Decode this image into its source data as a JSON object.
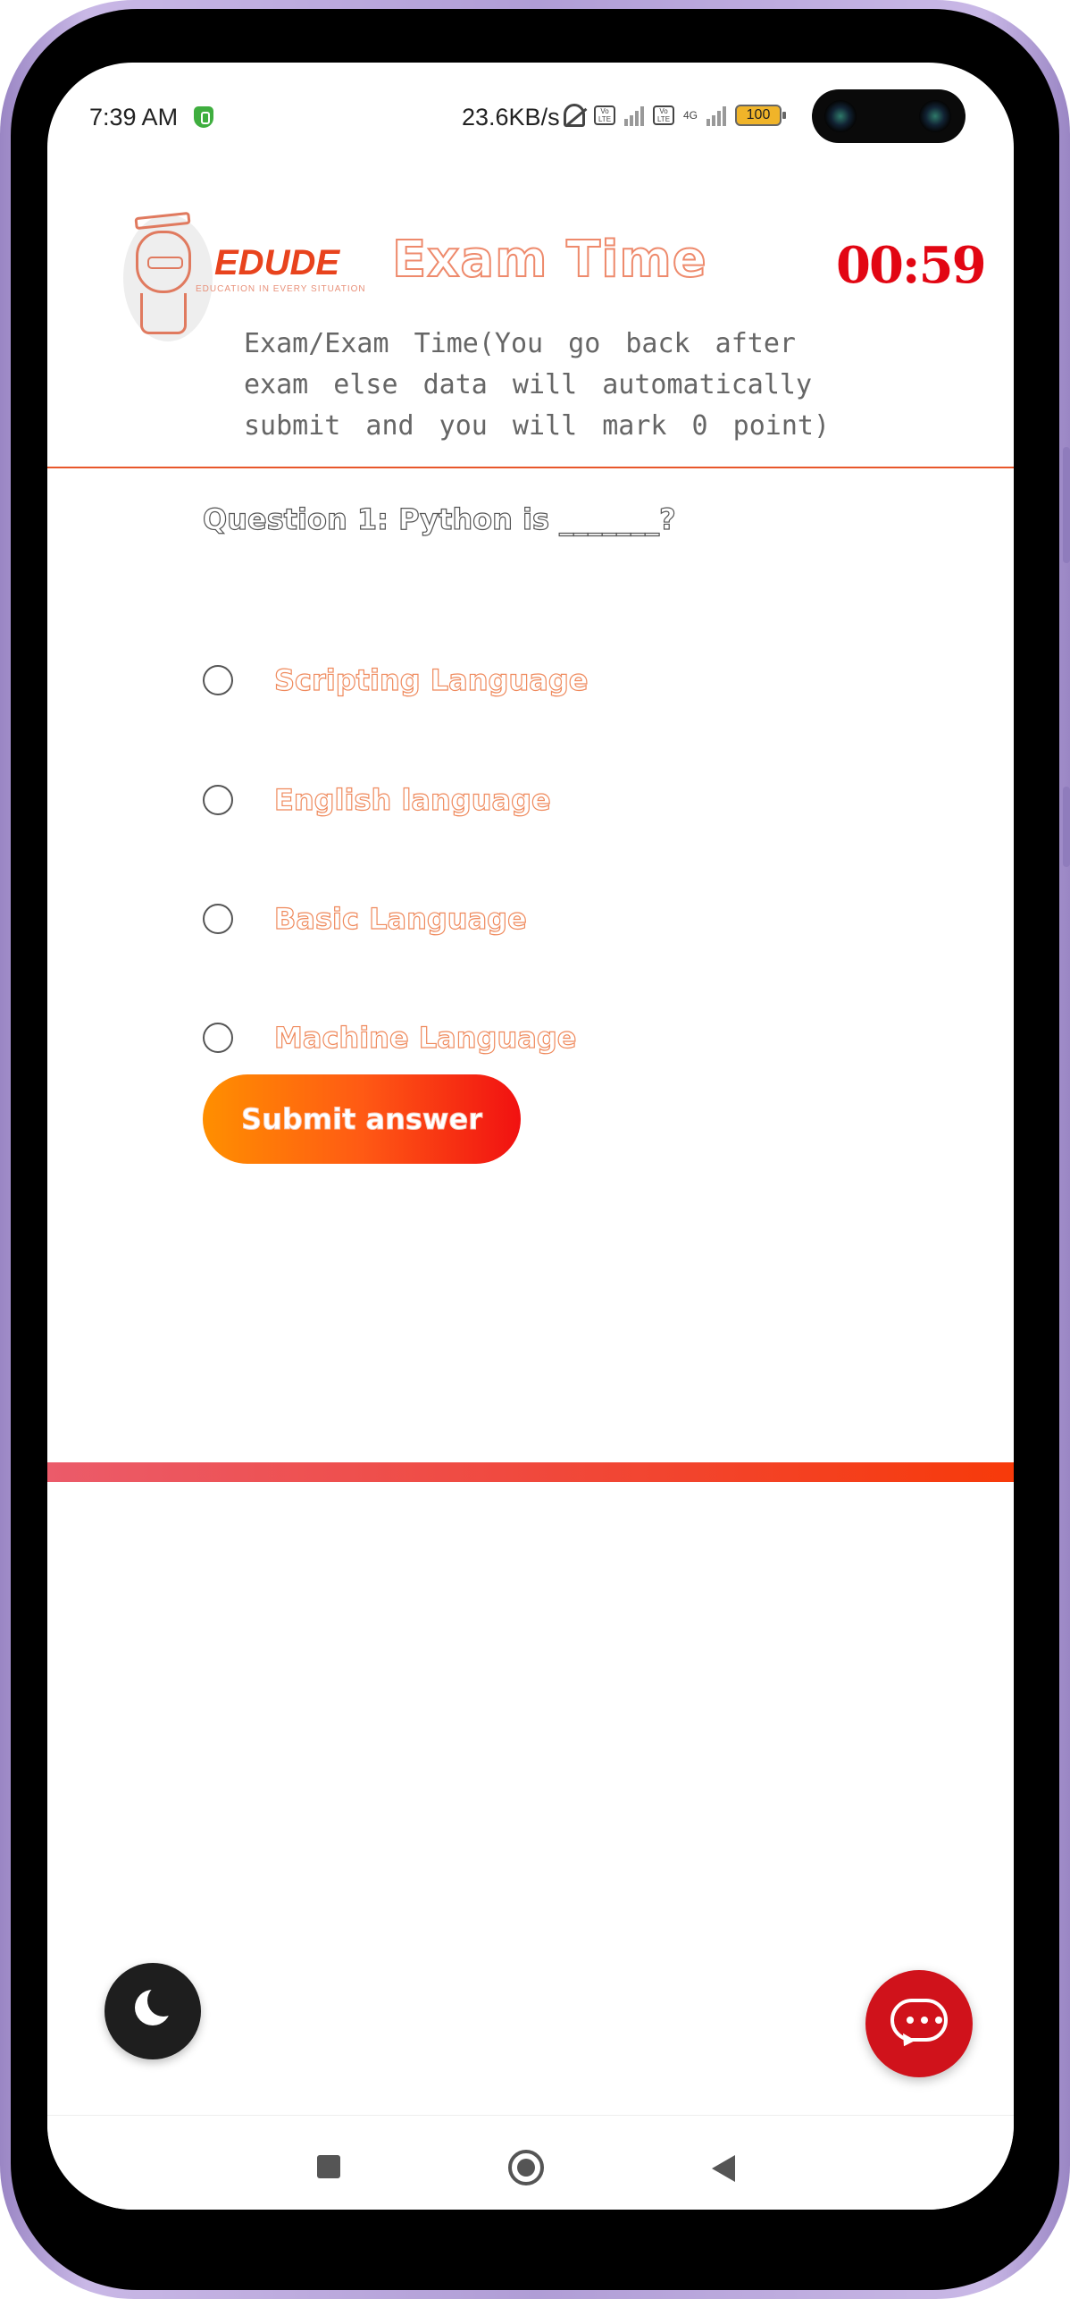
{
  "status_bar": {
    "time": "7:39 AM",
    "network_speed": "23.6KB/s",
    "battery": "100",
    "icons": [
      "shield-icon",
      "bell-muted-icon",
      "volte-icon",
      "signal-icon",
      "4g-icon",
      "battery-icon"
    ]
  },
  "header": {
    "brand_name": "EDUDE",
    "brand_tagline": "EDUCATION IN EVERY SITUATION",
    "title": "Exam Time",
    "timer": "00:59"
  },
  "notice": "Exam/Exam Time(You go back after exam else data will automatically submit and you will mark 0 point)",
  "question": {
    "text": "Question 1: Python is _______?",
    "options": [
      {
        "label": "Scripting Language",
        "selected": false
      },
      {
        "label": "English language",
        "selected": false
      },
      {
        "label": "Basic Language",
        "selected": false
      },
      {
        "label": "Machine Language",
        "selected": false
      }
    ]
  },
  "submit_label": "Submit answer",
  "colors": {
    "accent_orange": "#ff8f00",
    "accent_red": "#f11111",
    "timer_red": "#e20613",
    "divider": "#e8572b",
    "chat_button": "#d0121b",
    "dark_toggle": "#1e1e1e"
  },
  "floating": {
    "dark_mode_icon": "moon-icon",
    "chat_icon": "chat-bubble-icon"
  },
  "nav_bar": {
    "icons": [
      "recent-apps-icon",
      "home-icon",
      "back-icon"
    ]
  }
}
